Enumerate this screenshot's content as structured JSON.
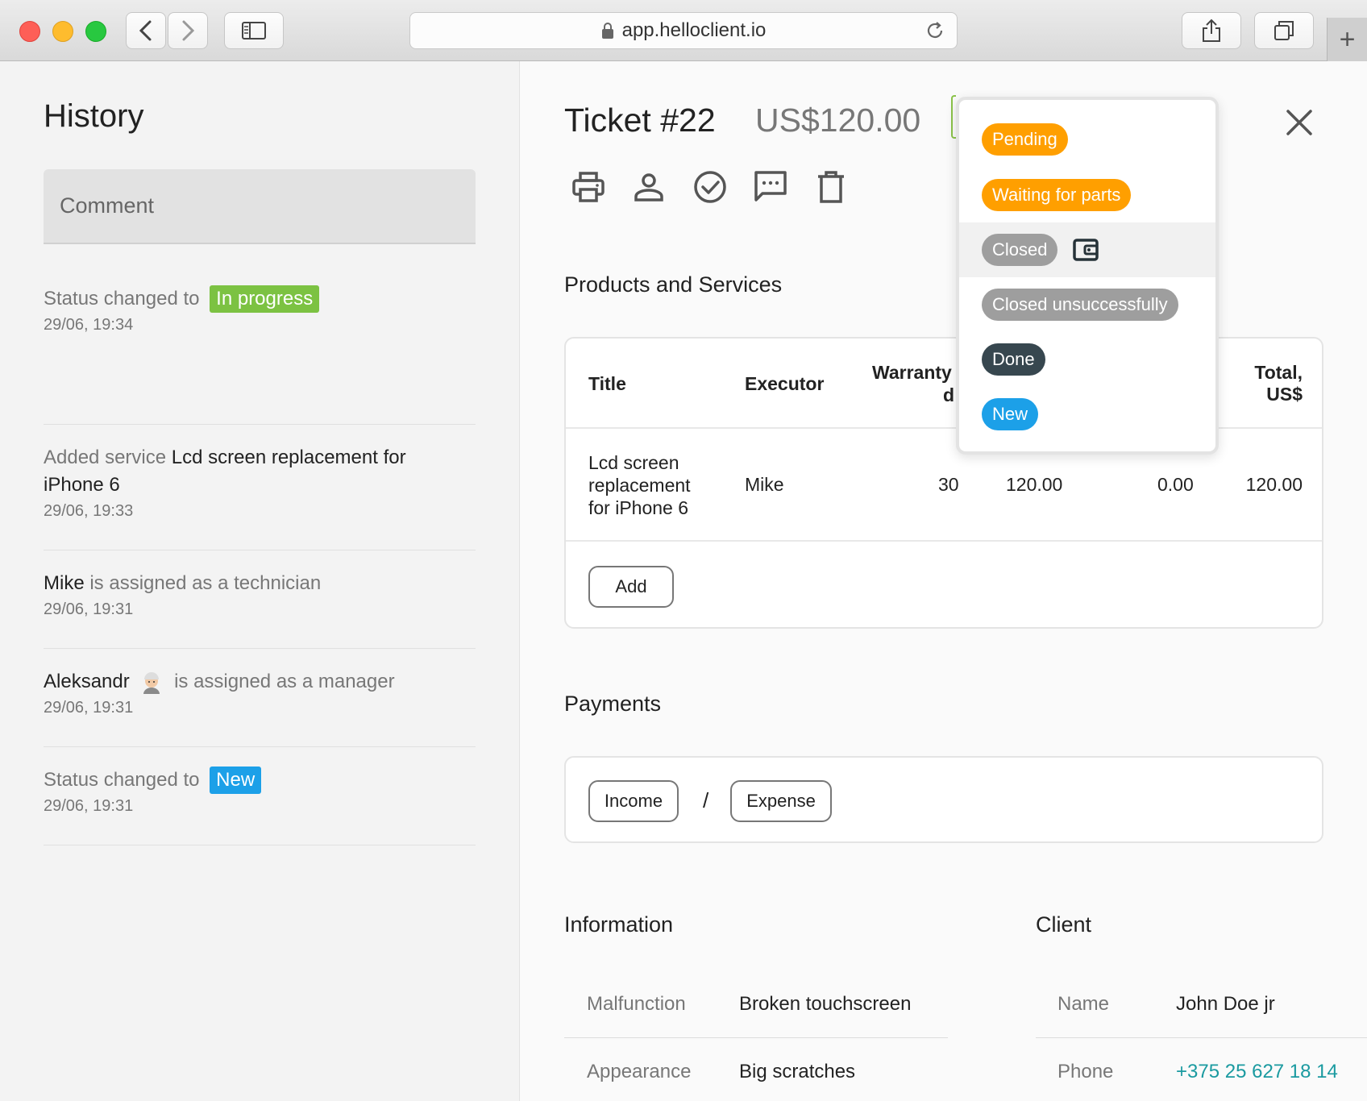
{
  "browser": {
    "url": "app.helloclient.io"
  },
  "history": {
    "title": "History",
    "comment_placeholder": "Comment",
    "items": [
      {
        "prefix": "Status changed to",
        "badge": "In progress",
        "badge_color": "#7cc242",
        "time": "29/06, 19:34"
      },
      {
        "prefix": "Added service",
        "subject": "Lcd screen replacement for iPhone 6",
        "time": "29/06, 19:33"
      },
      {
        "subject": "Mike",
        "suffix": "is assigned as a technician",
        "time": "29/06, 19:31"
      },
      {
        "subject": "Aleksandr",
        "suffix": "is assigned as a manager",
        "time": "29/06, 19:31"
      },
      {
        "prefix": "Status changed to",
        "badge": "New",
        "badge_color": "#1ca0e8",
        "time": "29/06, 19:31"
      }
    ]
  },
  "ticket": {
    "number": "Ticket #22",
    "price": "US$120.00",
    "toolbar": [
      "print-icon",
      "person-icon",
      "check-circle-icon",
      "comment-icon",
      "trash-icon"
    ]
  },
  "products": {
    "title": "Products and Services",
    "headers": {
      "title": "Title",
      "executor": "Executor",
      "warranty": "Warranty",
      "warranty_cut": "d",
      "total_line1": "Total,",
      "total_line2": "US$"
    },
    "rows": [
      {
        "title_lines": [
          "Lcd screen",
          "replacement",
          "for iPhone 6"
        ],
        "executor": "Mike",
        "warranty": "30",
        "price": "120.00",
        "discount": "0.00",
        "total": "120.00"
      }
    ],
    "add_label": "Add"
  },
  "payments": {
    "title": "Payments",
    "income_label": "Income",
    "separator": "/",
    "expense_label": "Expense"
  },
  "information": {
    "title": "Information",
    "rows": [
      {
        "key": "Malfunction",
        "value": "Broken touchscreen"
      },
      {
        "key": "Appearance",
        "value": "Big scratches"
      }
    ]
  },
  "client": {
    "title": "Client",
    "rows": [
      {
        "key": "Name",
        "value": "John Doe jr"
      },
      {
        "key": "Phone",
        "value": "+375 25 627 18 14"
      }
    ]
  },
  "status_dropdown": {
    "options": [
      {
        "label": "Pending",
        "color": "#ff9f00"
      },
      {
        "label": "Waiting for parts",
        "color": "#ff9f00"
      },
      {
        "label": "Closed",
        "color": "#9e9e9e",
        "icon": "wallet-icon",
        "highlighted": true
      },
      {
        "label": "Closed unsuccessfully",
        "color": "#9e9e9e"
      },
      {
        "label": "Done",
        "color": "#37474f"
      },
      {
        "label": "New",
        "color": "#1ca0e8"
      }
    ]
  }
}
